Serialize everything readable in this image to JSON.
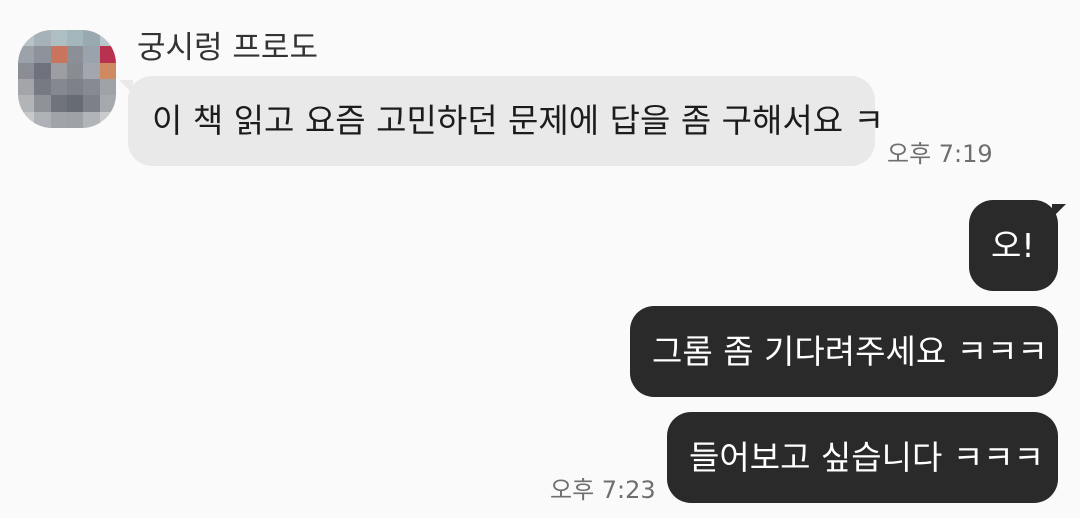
{
  "sender": {
    "name": "궁시렁 프로도",
    "avatar_colors": [
      "#b8c3c8",
      "#a7b2b8",
      "#aebfc3",
      "#a3b6bc",
      "#9aa9b0",
      "#b7c7cc",
      "#9ca2aa",
      "#8e939b",
      "#c9745c",
      "#8d8f96",
      "#9aa3ab",
      "#b8324f",
      "#8b8d95",
      "#6f727d",
      "#9d9ea4",
      "#8a8c93",
      "#a3a7ad",
      "#cf8a62",
      "#a3a5ab",
      "#777a83",
      "#868890",
      "#7e8189",
      "#878a92",
      "#9fa3a8",
      "#b2b5b8",
      "#8f9298",
      "#6e737c",
      "#676b74",
      "#7d8088",
      "#a5a9ae",
      "#c6c8ca",
      "#aeb2b6",
      "#a0a3a8",
      "#9ea1a6",
      "#b1b4b8",
      "#c9cbcd"
    ]
  },
  "messages": {
    "incoming": {
      "text": "이 책 읽고 요즘 고민하던 문제에 답을 좀 구해서요 ㅋ",
      "time": "오후 7:19"
    },
    "outgoing": [
      {
        "text": "오!"
      },
      {
        "text": "그롬 좀 기다려주세요 ㅋㅋㅋ"
      },
      {
        "text": "들어보고 싶습니다 ㅋㅋㅋ"
      }
    ],
    "outgoing_time": "오후 7:23"
  },
  "colors": {
    "background": "#fafafa",
    "incoming_bubble": "#e9e9ea",
    "outgoing_bubble": "#2a2a2a",
    "timestamp_text": "#6f6f6f"
  }
}
